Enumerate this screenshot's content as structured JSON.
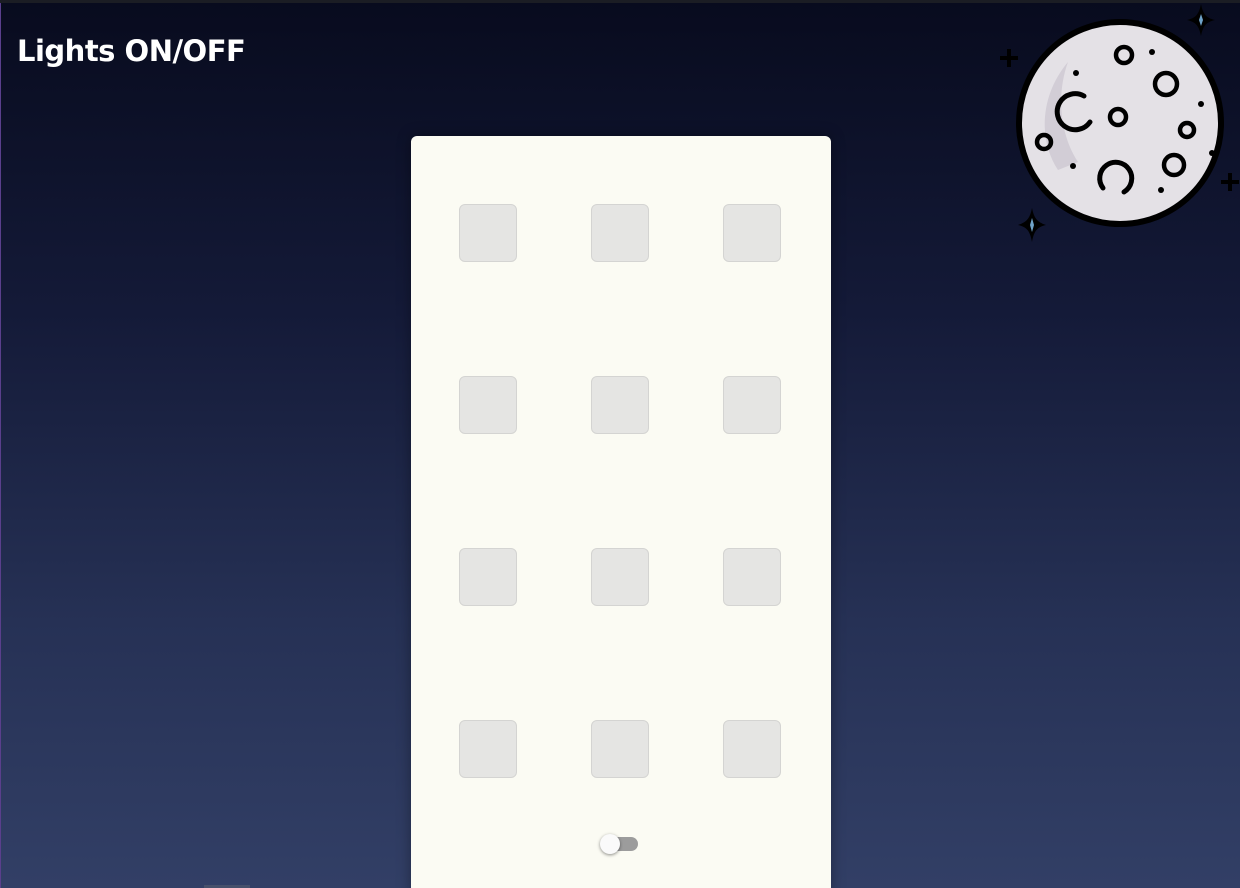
{
  "page": {
    "title": "Lights ON/OFF"
  },
  "icons": {
    "moon": "moon-icon",
    "star": "sparkle-star-icon"
  },
  "building": {
    "rows": 4,
    "columns": 3,
    "windows": [
      {
        "light_on": false
      },
      {
        "light_on": false
      },
      {
        "light_on": false
      },
      {
        "light_on": false
      },
      {
        "light_on": false
      },
      {
        "light_on": false
      },
      {
        "light_on": false
      },
      {
        "light_on": false
      },
      {
        "light_on": false
      },
      {
        "light_on": false
      },
      {
        "light_on": false
      },
      {
        "light_on": false
      }
    ]
  },
  "switch": {
    "state": "off"
  },
  "colors": {
    "sky_top": "#080b1e",
    "sky_bottom": "#323f66",
    "building": "#fbfbf3",
    "window_off": "#e5e5e3",
    "moon_fill": "#e4e1e6",
    "moon_outline": "#000000",
    "star_center": "#6fa3c9",
    "toggle_track": "#9c9c9c"
  }
}
